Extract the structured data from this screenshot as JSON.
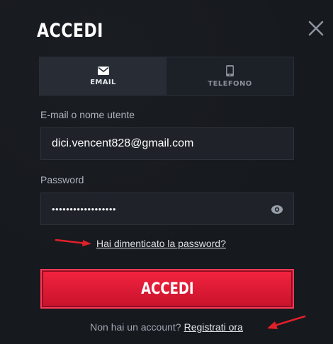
{
  "modal": {
    "title": "ACCEDI",
    "tabs": [
      {
        "label": "EMAIL",
        "icon": "envelope-icon",
        "active": true
      },
      {
        "label": "TELEFONO",
        "icon": "phone-icon",
        "active": false
      }
    ],
    "email_label": "E-mail o nome utente",
    "email_value": "dici.vencent828@gmail.com",
    "password_label": "Password",
    "password_value": "••••••••••••••••••",
    "forgot_link": "Hai dimenticato la password?",
    "submit_label": "ACCEDI",
    "footer_text": "Non hai un account?",
    "register_link": "Registrati ora"
  },
  "colors": {
    "accent": "#e8203a",
    "background": "#16191e",
    "annotation_arrow": "#e0202a"
  }
}
